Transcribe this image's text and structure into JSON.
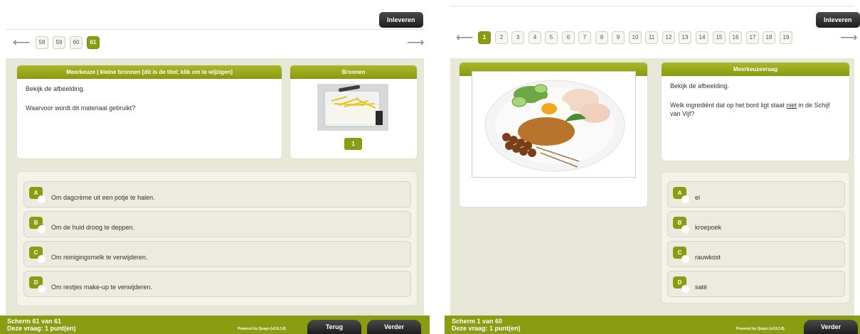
{
  "left": {
    "submit_label": "Inleveren",
    "pages": [
      "58",
      "59",
      "60",
      "61"
    ],
    "active_page": "61",
    "question_title": "Meerkeuze | kleine bronnen [dit is de titel; klik om te wijzigen]",
    "question_text": [
      "Bekijk de afbeelding.",
      "Waarvoor wordt dit materiaal gebruikt?"
    ],
    "sources_title": "Bronnen",
    "source_number": "1",
    "options": [
      {
        "letter": "A",
        "text": "Om dagcrème uit een potje te halen."
      },
      {
        "letter": "B",
        "text": "Om de huid droog te deppen."
      },
      {
        "letter": "C",
        "text": "Om reinigingsmelk te verwijderen."
      },
      {
        "letter": "D",
        "text": "Om restjes make-up te verwijderen."
      }
    ],
    "footer": {
      "screen": "Scherm 61 van 61",
      "points": "Deze vraag: 1 punt(en)",
      "powered": "Powered by Quayn (v2.8.3.8)",
      "back": "Terug",
      "next": "Verder"
    }
  },
  "right": {
    "submit_label": "Inleveren",
    "pages": [
      "1",
      "2",
      "3",
      "4",
      "5",
      "6",
      "7",
      "8",
      "9",
      "10",
      "11",
      "12",
      "13",
      "14",
      "15",
      "16",
      "17",
      "18",
      "19"
    ],
    "active_page": "1",
    "question_title": "Meerkeuzevraag",
    "question_text_1": "Bekijk de afbeelding.",
    "question_text_2a": "Welk ingrediënt dat op het bord ligt staat ",
    "question_text_2b": "niet",
    "question_text_2c": " in de Schijf van Vijf?",
    "options": [
      {
        "letter": "A",
        "text": "ei"
      },
      {
        "letter": "B",
        "text": "kroepoek"
      },
      {
        "letter": "C",
        "text": "rauwkost"
      },
      {
        "letter": "D",
        "text": "saté"
      }
    ],
    "footer": {
      "screen": "Scherm 1 van 60",
      "points": "Deze vraag: 1 punt(en)",
      "powered": "Powered by Quayn (v2.8.3.8)",
      "next": "Verder"
    }
  },
  "icons": {
    "prev": "arrow-left-icon",
    "next": "arrow-right-icon"
  },
  "colors": {
    "accent": "#8a9c12",
    "panel_bg": "#e8e8d8",
    "button_dark": "#2a2a2a"
  }
}
